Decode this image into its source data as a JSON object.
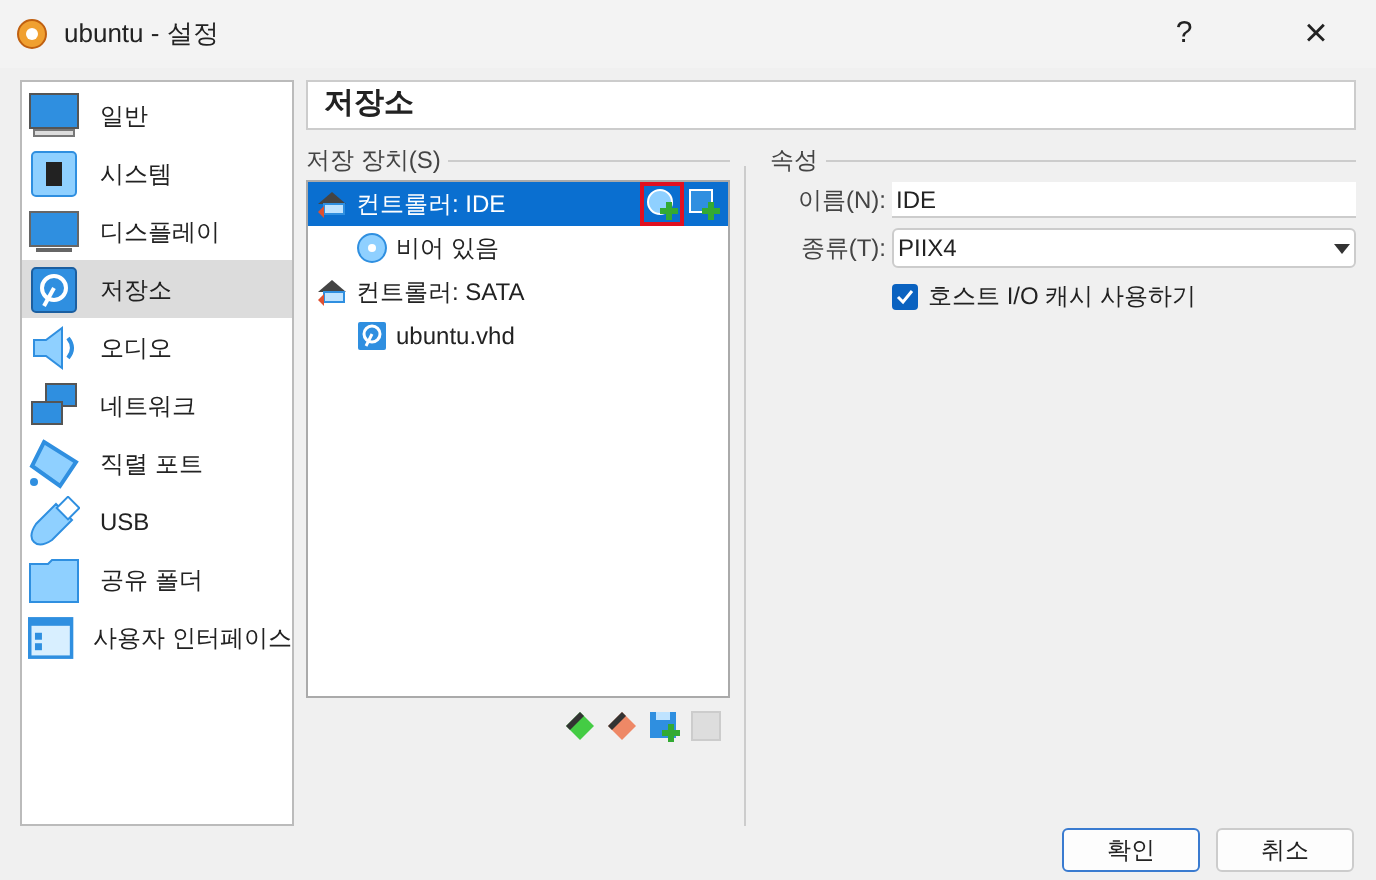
{
  "window": {
    "title": "ubuntu - 설정",
    "help": "?",
    "close": "×"
  },
  "sidebar": {
    "items": [
      {
        "label": "일반",
        "kind": "general",
        "selected": false
      },
      {
        "label": "시스템",
        "kind": "system",
        "selected": false
      },
      {
        "label": "디스플레이",
        "kind": "display",
        "selected": false
      },
      {
        "label": "저장소",
        "kind": "storage",
        "selected": true
      },
      {
        "label": "오디오",
        "kind": "audio",
        "selected": false
      },
      {
        "label": "네트워크",
        "kind": "network",
        "selected": false
      },
      {
        "label": "직렬 포트",
        "kind": "serial",
        "selected": false
      },
      {
        "label": "USB",
        "kind": "usb",
        "selected": false
      },
      {
        "label": "공유 폴더",
        "kind": "folder",
        "selected": false
      },
      {
        "label": "사용자 인터페이스",
        "kind": "ui",
        "selected": false
      }
    ]
  },
  "page_title": "저장소",
  "storage": {
    "label": "저장 장치(S)",
    "add_button_highlighted": true,
    "tree": [
      {
        "label": "컨트롤러: IDE",
        "kind": "controller",
        "selected": true,
        "children": [
          {
            "label": "비어 있음",
            "kind": "optical",
            "selected": false
          }
        ]
      },
      {
        "label": "컨트롤러: SATA",
        "kind": "controller",
        "selected": false,
        "children": [
          {
            "label": "ubuntu.vhd",
            "kind": "harddisk",
            "selected": false
          }
        ]
      }
    ]
  },
  "attributes": {
    "label": "속성",
    "name_label": "이름(N):",
    "name_value": "IDE",
    "type_label": "종류(T):",
    "type_value": "PIIX4",
    "cache": {
      "label": "호스트 I/O 캐시 사용하기",
      "checked": true
    }
  },
  "buttons": [
    {
      "label": "확인",
      "default": true
    },
    {
      "label": "취소",
      "default": false
    }
  ]
}
